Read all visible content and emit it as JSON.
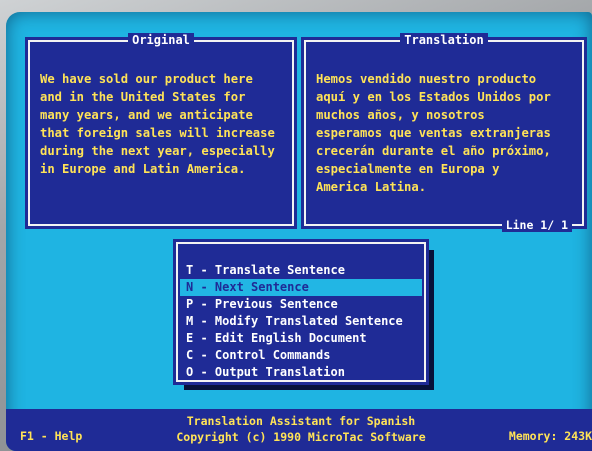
{
  "original_pane": {
    "title": "Original",
    "text": "We have sold our product here\nand in the United States for\nmany years, and we anticipate\nthat foreign sales will increase\nduring the next year, especially\nin Europe and Latin America."
  },
  "translation_pane": {
    "title": "Translation",
    "text": "Hemos vendido nuestro producto\naquí y en los Estados Unidos por\nmuchos años, y nosotros\nesperamos que ventas extranjeras\ncrecerán durante el año próximo,\nespecialmente en Europa y\nAmerica Latina.",
    "line_indicator": "Line   1/  1"
  },
  "menu": {
    "items": [
      {
        "key": "T",
        "label": "T - Translate Sentence"
      },
      {
        "key": "N",
        "label": "N - Next Sentence",
        "selected": true
      },
      {
        "key": "P",
        "label": "P - Previous Sentence"
      },
      {
        "key": "M",
        "label": "M - Modify Translated Sentence"
      },
      {
        "key": "E",
        "label": "E - Edit English Document"
      },
      {
        "key": "C",
        "label": "C - Control Commands"
      },
      {
        "key": "O",
        "label": "O - Output Translation"
      }
    ]
  },
  "status_bar": {
    "help": "F1 - Help",
    "app_name": "Translation Assistant for Spanish",
    "copyright": "Copyright (c) 1990 MicroTac Software",
    "memory": "Memory: 243K"
  },
  "colors": {
    "background": "#1fb4e2",
    "pane": "#1f2b96",
    "text": "#ffe357",
    "highlight": "#22b6e4"
  }
}
